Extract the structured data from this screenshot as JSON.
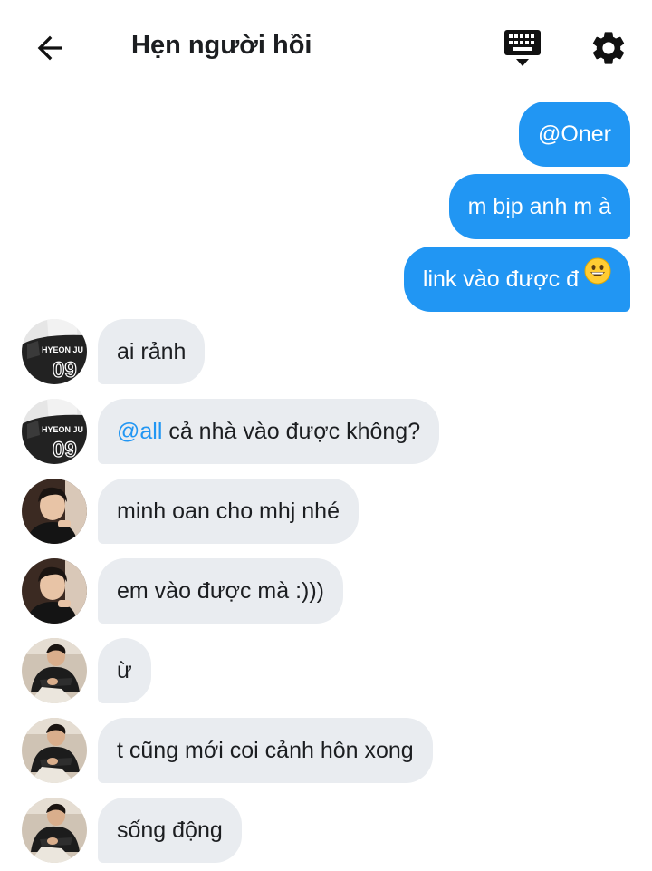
{
  "header": {
    "title": "Hẹn người hồi",
    "back_icon": "arrow-left-icon",
    "keyboard_icon": "keyboard-hide-icon",
    "settings_icon": "gear-icon"
  },
  "colors": {
    "outgoing_bubble": "#2196f3",
    "incoming_bubble": "#e9ecf0",
    "mention": "#2196f3"
  },
  "messages": [
    {
      "direction": "out",
      "text": "@Oner"
    },
    {
      "direction": "out",
      "text": "m bịp anh m à"
    },
    {
      "direction": "out",
      "text": "link vào được đ",
      "emoji": "grinning-face-emoji"
    },
    {
      "direction": "in",
      "sender_avatar": "jersey-avatar",
      "text": "ai rảnh"
    },
    {
      "direction": "in",
      "sender_avatar": "jersey-avatar",
      "mention": "@all",
      "text": " cả nhà vào được không?"
    },
    {
      "direction": "in",
      "sender_avatar": "portrait-avatar",
      "text": "minh oan cho mhj nhé"
    },
    {
      "direction": "in",
      "sender_avatar": "portrait-avatar",
      "text": "em vào được mà :)))"
    },
    {
      "direction": "in",
      "sender_avatar": "crouching-avatar",
      "text": "ừ"
    },
    {
      "direction": "in",
      "sender_avatar": "crouching-avatar",
      "text": "t cũng mới coi cảnh hôn xong"
    },
    {
      "direction": "in",
      "sender_avatar": "crouching-avatar",
      "text": "sống động"
    }
  ]
}
